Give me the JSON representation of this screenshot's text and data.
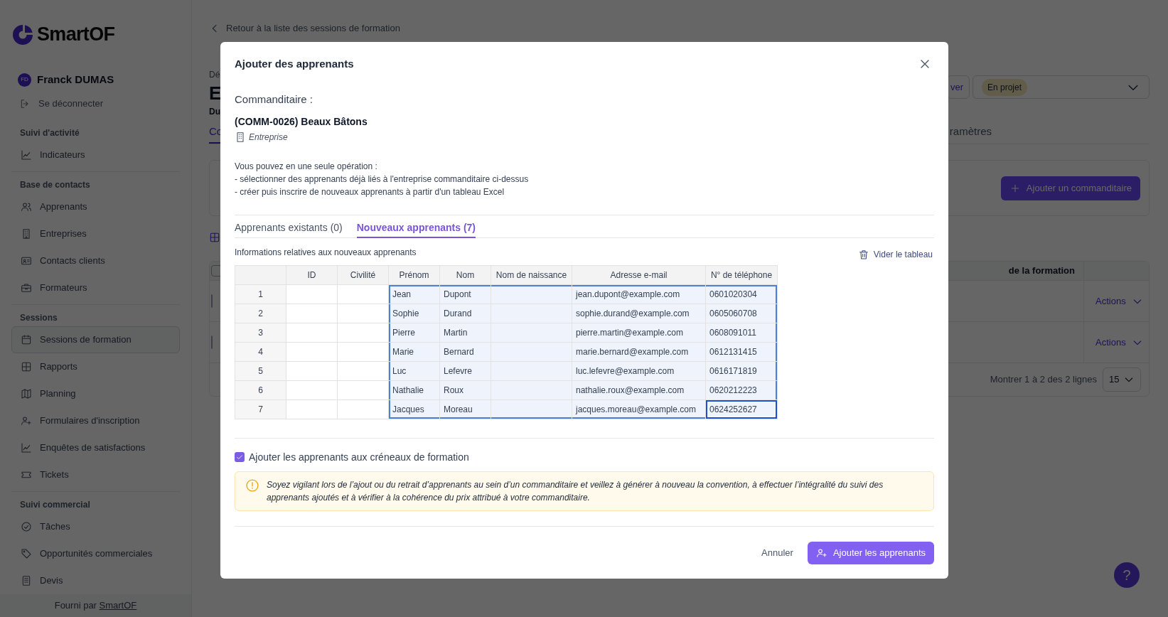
{
  "sidebar": {
    "logo": "SmartOF",
    "user": {
      "initials": "FD",
      "name": "Franck DUMAS"
    },
    "logout": "Se déconnecter",
    "sections": [
      {
        "title": "Suivi d'activité",
        "items": [
          {
            "label": "Indicateurs",
            "selected": false
          }
        ]
      },
      {
        "title": "Base de contacts",
        "items": [
          {
            "label": "Apprenants",
            "selected": false
          },
          {
            "label": "Entreprises",
            "selected": false
          },
          {
            "label": "Contacts clients",
            "selected": false
          },
          {
            "label": "Formateurs",
            "selected": false
          }
        ]
      },
      {
        "title": "Sessions",
        "items": [
          {
            "label": "Sessions de formation",
            "selected": true
          },
          {
            "label": "Rapports",
            "selected": false
          },
          {
            "label": "Planning",
            "selected": false
          },
          {
            "label": "Formulaires d'inscription",
            "selected": false
          },
          {
            "label": "Enquêtes de satisfactions",
            "selected": false
          },
          {
            "label": "Tickets",
            "selected": false
          }
        ]
      },
      {
        "title": "Suivi commercial",
        "items": [
          {
            "label": "Tâches",
            "selected": false
          },
          {
            "label": "Opportunités commerciales",
            "selected": false
          },
          {
            "label": "Devis",
            "selected": false
          }
        ]
      }
    ],
    "footer": {
      "text": "Fourni par ",
      "link": "SmartOF"
    }
  },
  "page": {
    "back_link": "Retour à la liste des sessions de formation",
    "breadcrumb": "Dé",
    "title": "E",
    "subtitle": "Du",
    "tabs": [
      {
        "label": "Co",
        "selected": true
      },
      {
        "label": "ramètres",
        "selected": false
      }
    ],
    "archive_button": "ver",
    "status_select": {
      "value": "En projet"
    },
    "add_client_button": "Ajouter un commanditaire",
    "table": {
      "column": "de la formation",
      "select_all": {
        "checked": false
      },
      "rows": [
        {
          "checked": false,
          "action": "Actions"
        },
        {
          "checked": false,
          "action": "Actions"
        }
      ],
      "pagination": "Montrer 1 à 2 des 2 lignes",
      "page_size": "15"
    }
  },
  "help_button": "?",
  "modal": {
    "title": "Ajouter des apprenants",
    "client_label": "Commanditaire :",
    "client_name": "(COMM-0026) Beaux Bâtons",
    "client_type": "Entreprise",
    "intro": [
      "Vous pouvez en une seule opération :",
      "- sélectionner des apprenants déjà liés à l'entreprise commanditaire ci-dessus",
      "- créer puis inscrire de nouveaux apprenants à partir d'un tableau Excel"
    ],
    "tabs": [
      {
        "label": "Apprenants existants (0)",
        "selected": false
      },
      {
        "label": "Nouveaux apprenants (7)",
        "selected": true
      }
    ],
    "table_caption": "Informations relatives aux nouveaux apprenants",
    "clear_button": "Vider le tableau",
    "columns": [
      "ID",
      "Civilité",
      "Prénom",
      "Nom",
      "Nom de naissance",
      "Adresse e-mail",
      "N° de téléphone"
    ],
    "rows": [
      {
        "number": "1",
        "cells": [
          {
            "selected": false,
            "active": false
          },
          {
            "selected": false,
            "active": false
          },
          {
            "text": "Jean",
            "selected": true,
            "active": false
          },
          {
            "text": "Dupont",
            "selected": true,
            "active": false
          },
          {
            "selected": true,
            "active": false
          },
          {
            "text": "jean.dupont@example.com",
            "selected": true,
            "active": false
          },
          {
            "text": "0601020304",
            "selected": true,
            "active": false
          }
        ]
      },
      {
        "number": "2",
        "cells": [
          {
            "selected": false,
            "active": false
          },
          {
            "selected": false,
            "active": false
          },
          {
            "text": "Sophie",
            "selected": true,
            "active": false
          },
          {
            "text": "Durand",
            "selected": true,
            "active": false
          },
          {
            "selected": true,
            "active": false
          },
          {
            "text": "sophie.durand@example.com",
            "selected": true,
            "active": false
          },
          {
            "text": "0605060708",
            "selected": true,
            "active": false
          }
        ]
      },
      {
        "number": "3",
        "cells": [
          {
            "selected": false,
            "active": false
          },
          {
            "selected": false,
            "active": false
          },
          {
            "text": "Pierre",
            "selected": true,
            "active": false
          },
          {
            "text": "Martin",
            "selected": true,
            "active": false
          },
          {
            "selected": true,
            "active": false
          },
          {
            "text": "pierre.martin@example.com",
            "selected": true,
            "active": false
          },
          {
            "text": "0608091011",
            "selected": true,
            "active": false
          }
        ]
      },
      {
        "number": "4",
        "cells": [
          {
            "selected": false,
            "active": false
          },
          {
            "selected": false,
            "active": false
          },
          {
            "text": "Marie",
            "selected": true,
            "active": false
          },
          {
            "text": "Bernard",
            "selected": true,
            "active": false
          },
          {
            "selected": true,
            "active": false
          },
          {
            "text": "marie.bernard@example.com",
            "selected": true,
            "active": false
          },
          {
            "text": "0612131415",
            "selected": true,
            "active": false
          }
        ]
      },
      {
        "number": "5",
        "cells": [
          {
            "selected": false,
            "active": false
          },
          {
            "selected": false,
            "active": false
          },
          {
            "text": "Luc",
            "selected": true,
            "active": false
          },
          {
            "text": "Lefevre",
            "selected": true,
            "active": false
          },
          {
            "selected": true,
            "active": false
          },
          {
            "text": "luc.lefevre@example.com",
            "selected": true,
            "active": false
          },
          {
            "text": "0616171819",
            "selected": true,
            "active": false
          }
        ]
      },
      {
        "number": "6",
        "cells": [
          {
            "selected": false,
            "active": false
          },
          {
            "selected": false,
            "active": false
          },
          {
            "text": "Nathalie",
            "selected": true,
            "active": false
          },
          {
            "text": "Roux",
            "selected": true,
            "active": false
          },
          {
            "selected": true,
            "active": false
          },
          {
            "text": "nathalie.roux@example.com",
            "selected": true,
            "active": false
          },
          {
            "text": "0620212223",
            "selected": true,
            "active": false
          }
        ]
      },
      {
        "number": "7",
        "cells": [
          {
            "selected": false,
            "active": false
          },
          {
            "selected": false,
            "active": false
          },
          {
            "text": "Jacques",
            "selected": true,
            "active": false
          },
          {
            "text": "Moreau",
            "selected": true,
            "active": false
          },
          {
            "selected": true,
            "active": false
          },
          {
            "text": "jacques.moreau@example.com",
            "selected": true,
            "active": false
          },
          {
            "text": "0624252627",
            "selected": true,
            "active": true
          }
        ]
      }
    ],
    "checkbox": {
      "label": "Ajouter les apprenants aux créneaux de formation",
      "checked": true
    },
    "warning": "Soyez vigilant lors de l’ajout ou du retrait d’apprenants au sein d’un commanditaire et veillez à générer à nouveau la convention, à effectuer l’intégralité du suivi des apprenants ajoutés et à vérifier à la cohérence du prix attribué à votre commanditaire.",
    "cancel_button": "Annuler",
    "submit_button": "Ajouter les apprenants"
  }
}
